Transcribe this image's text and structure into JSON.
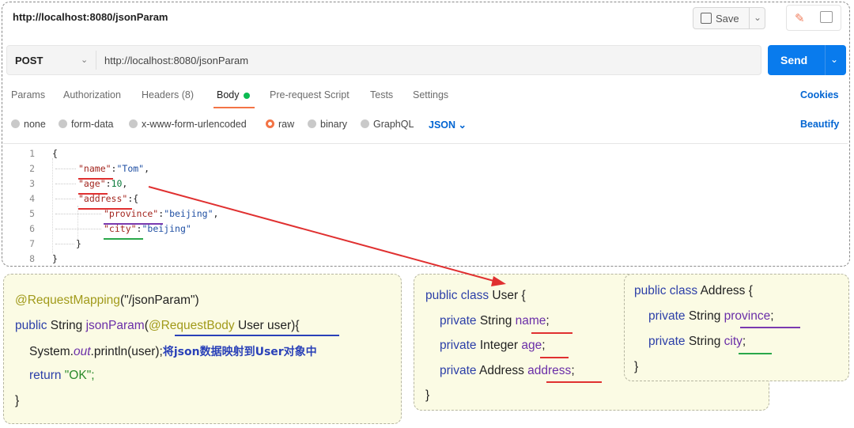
{
  "window": {
    "url_title": "http://localhost:8080/jsonParam"
  },
  "toolbar": {
    "save_label": "Save"
  },
  "request": {
    "method": "POST",
    "url": "http://localhost:8080/jsonParam",
    "send_label": "Send"
  },
  "tabs": [
    {
      "label": "Params"
    },
    {
      "label": "Authorization"
    },
    {
      "label": "Headers (8)"
    },
    {
      "label": "Body"
    },
    {
      "label": "Pre-request Script"
    },
    {
      "label": "Tests"
    },
    {
      "label": "Settings"
    }
  ],
  "cookies_label": "Cookies",
  "body_types": [
    {
      "label": "none"
    },
    {
      "label": "form-data"
    },
    {
      "label": "x-www-form-urlencoded"
    },
    {
      "label": "raw",
      "selected": true
    },
    {
      "label": "binary"
    },
    {
      "label": "GraphQL"
    }
  ],
  "format": "JSON",
  "beautify_label": "Beautify",
  "editor": {
    "line_numbers": [
      "1",
      "2",
      "3",
      "4",
      "5",
      "6",
      "7",
      "8"
    ],
    "lines": [
      "{",
      "\"name\":\"Tom\",",
      "\"age\":10,",
      "\"address\":{",
      "\"province\":\"beijing\",",
      "\"city\":\"beijing\"",
      "}",
      "}"
    ]
  },
  "controller_code": {
    "l1_ann": "@RequestMapping",
    "l1_rest": "(\"/jsonParam\")",
    "l2_kw": "public",
    "l2_type": " String ",
    "l2_name": "jsonParam",
    "l2_paren": "(",
    "l2_ann": "@RequestBody",
    "l2_rest": " User user){",
    "l3_a": "System.",
    "l3_out": "out",
    "l3_b": ".println(user);",
    "l3_note": "将json数据映射到User对象中",
    "l4_kw": "return",
    "l4_str": " \"OK\";",
    "l5": "}"
  },
  "user_class": {
    "header_kw": "public class",
    "header_rest": " User {",
    "f1_kw": "private",
    "f1_type": " String ",
    "f1_name": "name",
    "f2_kw": "private",
    "f2_type": " Integer ",
    "f2_name": "age",
    "f3_kw": "private",
    "f3_type": " Address ",
    "f3_name": "address",
    "close": "}"
  },
  "address_class": {
    "header_kw": "public class",
    "header_rest": " Address {",
    "f1_kw": "private",
    "f1_type": " String ",
    "f1_name": "province",
    "f2_kw": "private",
    "f2_type": " String ",
    "f2_name": "city",
    "close": "}"
  },
  "colors": {
    "send": "#097bed",
    "accent": "#f37446",
    "red_underline": "#e03030",
    "green_underline": "#2aa84a",
    "purple_underline": "#7a3ab0"
  }
}
